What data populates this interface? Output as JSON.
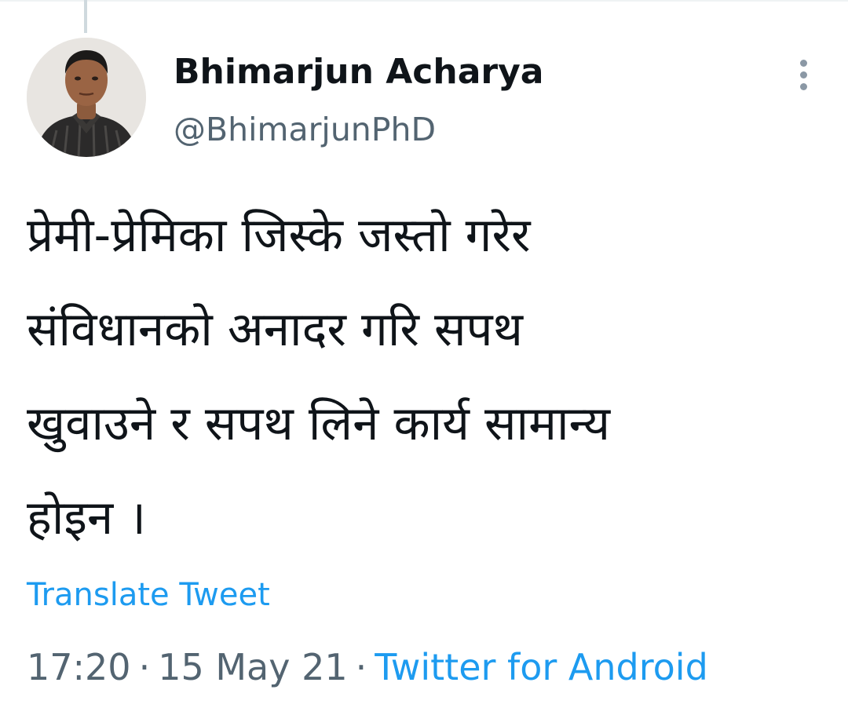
{
  "tweet": {
    "author": {
      "display_name": "Bhimarjun Acharya",
      "handle": "@BhimarjunPhD",
      "avatar_icon": "profile-photo-icon"
    },
    "more_icon": "vertical-ellipsis-icon",
    "text_lines": [
      "प्रेमी-प्रेमिका जिस्के जस्तो गरेर",
      "संविधानको अनादर गरि सपथ",
      "खुवाउने र सपथ लिने कार्य सामान्य",
      "होइन ।"
    ],
    "translate_label": "Translate Tweet",
    "time": "17:20",
    "date": "15 May 21",
    "separator": "·",
    "source": "Twitter for Android"
  },
  "colors": {
    "text_primary": "#0f1419",
    "text_secondary": "#536471",
    "link": "#1d9bf0",
    "icon_muted": "#8b98a5"
  }
}
